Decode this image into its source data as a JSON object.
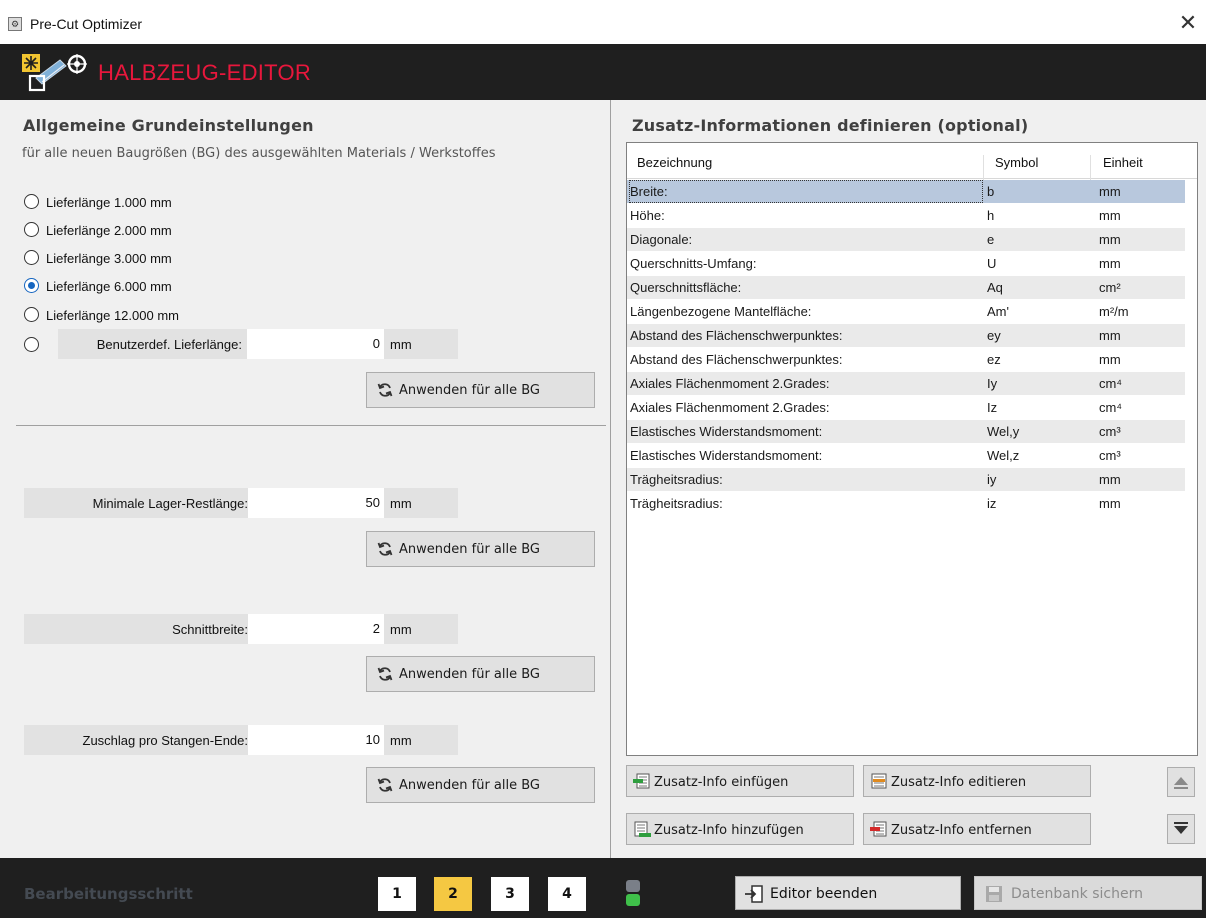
{
  "window": {
    "title": "Pre-Cut Optimizer",
    "close_glyph": "✕",
    "icon": "app-icon"
  },
  "header": {
    "title": "HALBZEUG-EDITOR",
    "logo": "halbzeug-logo"
  },
  "general": {
    "heading": "Allgemeine Grundeinstellungen",
    "subtitle": "für alle neuen Baugrößen (BG) des ausgewählten Materials / Werkstoffes",
    "delivery_lengths": [
      {
        "label": "Lieferlänge 1.000 mm",
        "checked": false
      },
      {
        "label": "Lieferlänge 2.000 mm",
        "checked": false
      },
      {
        "label": "Lieferlänge 3.000 mm",
        "checked": false
      },
      {
        "label": "Lieferlänge 6.000 mm",
        "checked": true
      },
      {
        "label": "Lieferlänge 12.000 mm",
        "checked": false
      }
    ],
    "custom_length": {
      "label": "Benutzerdef. Lieferlänge:",
      "value": "0",
      "unit": "mm",
      "checked": false
    },
    "apply_label": "Anwenden für alle BG",
    "min_rest": {
      "label": "Minimale Lager-Restlänge:",
      "value": "50",
      "unit": "mm"
    },
    "cut_width": {
      "label": "Schnittbreite:",
      "value": "2",
      "unit": "mm"
    },
    "allowance": {
      "label": "Zuschlag pro Stangen-Ende:",
      "value": "10",
      "unit": "mm"
    }
  },
  "extra": {
    "heading": "Zusatz-Informationen definieren (optional)",
    "columns": [
      "Bezeichnung",
      "Symbol",
      "Einheit"
    ],
    "selected_row": 0,
    "rows": [
      [
        "Breite:",
        "b",
        "mm"
      ],
      [
        "Höhe:",
        "h",
        "mm"
      ],
      [
        "Diagonale:",
        "e",
        "mm"
      ],
      [
        "Querschnitts-Umfang:",
        "U",
        "mm"
      ],
      [
        "Querschnittsfläche:",
        "Aq",
        "cm²"
      ],
      [
        "Längenbezogene Mantelfläche:",
        "Am'",
        "m²/m"
      ],
      [
        "Abstand des Flächenschwerpunktes:",
        "ey",
        "mm"
      ],
      [
        "Abstand des Flächenschwerpunktes:",
        "ez",
        "mm"
      ],
      [
        "Axiales Flächenmoment 2.Grades:",
        "Iy",
        "cm⁴"
      ],
      [
        "Axiales Flächenmoment 2.Grades:",
        "Iz",
        "cm⁴"
      ],
      [
        "Elastisches Widerstandsmoment:",
        "Wel,y",
        "cm³"
      ],
      [
        "Elastisches Widerstandsmoment:",
        "Wel,z",
        "cm³"
      ],
      [
        "Trägheitsradius:",
        "iy",
        "mm"
      ],
      [
        "Trägheitsradius:",
        "iz",
        "mm"
      ]
    ],
    "buttons": {
      "insert": "Zusatz-Info einfügen",
      "edit": "Zusatz-Info editieren",
      "add": "Zusatz-Info hinzufügen",
      "remove": "Zusatz-Info entfernen"
    }
  },
  "footer": {
    "label": "Bearbeitungsschritt",
    "steps": [
      "1",
      "2",
      "3",
      "4"
    ],
    "active_step": "2",
    "exit_label": "Editor beenden",
    "save_label": "Datenbank sichern"
  },
  "colors": {
    "accent_red": "#e8173c",
    "step_active": "#f5c842",
    "selection": "#b8c8dd",
    "dark_bar": "#1f1f1f"
  }
}
